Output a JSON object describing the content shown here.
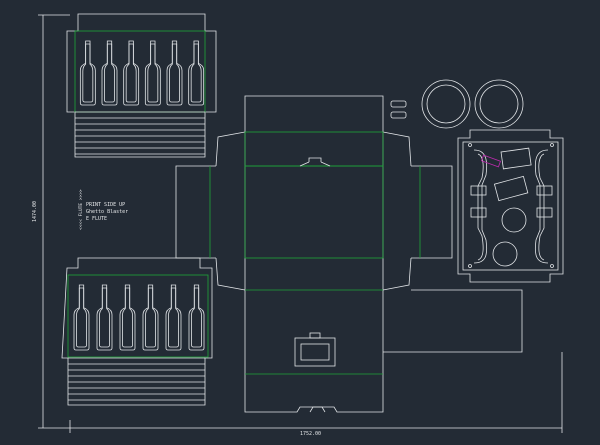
{
  "note": {
    "line1": "PRINT SIDE UP",
    "line2": "Ghetto Blaster",
    "line3": "E FLUTE",
    "flute_marker": "<<<< FLUTE >>>>"
  },
  "dimensions": {
    "height": "1474.00",
    "width": "1752.00"
  },
  "colors": {
    "background": "#232b35",
    "cut_line": "#e2e5e8",
    "fold_line": "#1fa53a",
    "accent": "#c02bb0"
  },
  "bottles": {
    "top_panel_count": 6,
    "bottom_panel_count": 6
  }
}
